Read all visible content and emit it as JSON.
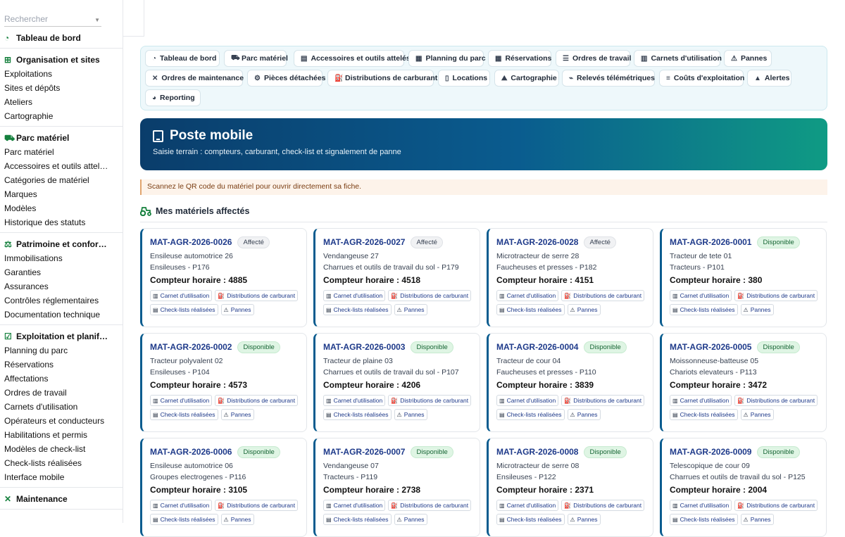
{
  "sidebar": {
    "search_placeholder": "Rechercher",
    "sections": [
      {
        "title": "Tableau de bord",
        "icon": "gauge-icon",
        "items": []
      },
      {
        "title": "Organisation et sites",
        "icon": "sitemap-icon",
        "items": [
          "Exploitations",
          "Sites et dépôts",
          "Ateliers",
          "Cartographie"
        ]
      },
      {
        "title": "Parc matériel",
        "icon": "tractor-icon",
        "items": [
          "Parc matériel",
          "Accessoires et outils attel…",
          "Catégories de matériel",
          "Marques",
          "Modèles",
          "Historique des statuts"
        ]
      },
      {
        "title": "Patrimoine et confor…",
        "icon": "scale-icon",
        "items": [
          "Immobilisations",
          "Garanties",
          "Assurances",
          "Contrôles réglementaires",
          "Documentation technique"
        ]
      },
      {
        "title": "Exploitation et planif…",
        "icon": "clipboard-check-icon",
        "items": [
          "Planning du parc",
          "Réservations",
          "Affectations",
          "Ordres de travail",
          "Carnets d'utilisation",
          "Opérateurs et conducteurs",
          "Habilitations et permis",
          "Modèles de check-list",
          "Check-lists réalisées",
          "Interface mobile"
        ]
      },
      {
        "title": "Maintenance",
        "icon": "tools-icon",
        "items": []
      }
    ]
  },
  "nav": [
    {
      "label": "Tableau de bord",
      "icon": "gauge-icon",
      "glyph": "◔"
    },
    {
      "label": "Parc matériel",
      "icon": "tractor-icon",
      "glyph": "⛟"
    },
    {
      "label": "Accessoires et outils attelés",
      "icon": "toolbox-icon",
      "glyph": "▤"
    },
    {
      "label": "Planning du parc",
      "icon": "calendar-icon",
      "glyph": "▦"
    },
    {
      "label": "Réservations",
      "icon": "calendar-check-icon",
      "glyph": "▦"
    },
    {
      "label": "Ordres de travail",
      "icon": "list-icon",
      "glyph": "☰"
    },
    {
      "label": "Carnets d'utilisation",
      "icon": "book-icon",
      "glyph": "▥"
    },
    {
      "label": "Pannes",
      "icon": "warning-icon",
      "glyph": "⚠"
    },
    {
      "label": "Ordres de maintenance",
      "icon": "tools-icon",
      "glyph": "✕"
    },
    {
      "label": "Pièces détachées",
      "icon": "gear-icon",
      "glyph": "⚙"
    },
    {
      "label": "Distributions de carburant",
      "icon": "fuel-icon",
      "glyph": "⛽"
    },
    {
      "label": "Locations",
      "icon": "file-contract-icon",
      "glyph": "▯"
    },
    {
      "label": "Cartographie",
      "icon": "map-icon",
      "glyph": "⛰"
    },
    {
      "label": "Relevés télémétriques",
      "icon": "satellite-icon",
      "glyph": "⌁"
    },
    {
      "label": "Coûts d'exploitation",
      "icon": "coins-icon",
      "glyph": "≡"
    },
    {
      "label": "Alertes",
      "icon": "bell-icon",
      "glyph": "▲"
    },
    {
      "label": "Reporting",
      "icon": "chart-pie-icon",
      "glyph": "◕"
    }
  ],
  "hero": {
    "title": "Poste mobile",
    "subtitle": "Saisie terrain : compteurs, carburant, check-list et signalement de panne"
  },
  "alert": "Scannez le QR code du matériel pour ouvrir directement sa fiche.",
  "assigned_title": "Mes matériels affectés",
  "labels": {
    "counter": "Compteur horaire : ",
    "carnet": "Carnet d'utilisation",
    "fuel": "Distributions de carburant",
    "checklists": "Check-lists réalisées",
    "pannes": "Pannes"
  },
  "colors": {
    "accent": "#0a5c8f",
    "available_bg": "#dff5e4",
    "available_fg": "#166534"
  },
  "cards": [
    {
      "code": "MAT-AGR-2026-0026",
      "status": "Affecté",
      "name": "Ensileuse automotrice 26",
      "detail": "Ensileuses - P176",
      "counter": "4885"
    },
    {
      "code": "MAT-AGR-2026-0027",
      "status": "Affecté",
      "name": "Vendangeuse 27",
      "detail": "Charrues et outils de travail du sol - P179",
      "counter": "4518"
    },
    {
      "code": "MAT-AGR-2026-0028",
      "status": "Affecté",
      "name": "Microtracteur de serre 28",
      "detail": "Faucheuses et presses - P182",
      "counter": "4151"
    },
    {
      "code": "MAT-AGR-2026-0001",
      "status": "Disponible",
      "name": "Tracteur de tete 01",
      "detail": "Tracteurs - P101",
      "counter": "380"
    },
    {
      "code": "MAT-AGR-2026-0002",
      "status": "Disponible",
      "name": "Tracteur polyvalent 02",
      "detail": "Ensileuses - P104",
      "counter": "4573"
    },
    {
      "code": "MAT-AGR-2026-0003",
      "status": "Disponible",
      "name": "Tracteur de plaine 03",
      "detail": "Charrues et outils de travail du sol - P107",
      "counter": "4206"
    },
    {
      "code": "MAT-AGR-2026-0004",
      "status": "Disponible",
      "name": "Tracteur de cour 04",
      "detail": "Faucheuses et presses - P110",
      "counter": "3839"
    },
    {
      "code": "MAT-AGR-2026-0005",
      "status": "Disponible",
      "name": "Moissonneuse-batteuse 05",
      "detail": "Chariots elevateurs - P113",
      "counter": "3472"
    },
    {
      "code": "MAT-AGR-2026-0006",
      "status": "Disponible",
      "name": "Ensileuse automotrice 06",
      "detail": "Groupes electrogenes - P116",
      "counter": "3105"
    },
    {
      "code": "MAT-AGR-2026-0007",
      "status": "Disponible",
      "name": "Vendangeuse 07",
      "detail": "Tracteurs - P119",
      "counter": "2738"
    },
    {
      "code": "MAT-AGR-2026-0008",
      "status": "Disponible",
      "name": "Microtracteur de serre 08",
      "detail": "Ensileuses - P122",
      "counter": "2371"
    },
    {
      "code": "MAT-AGR-2026-0009",
      "status": "Disponible",
      "name": "Telescopique de cour 09",
      "detail": "Charrues et outils de travail du sol - P125",
      "counter": "2004"
    }
  ]
}
